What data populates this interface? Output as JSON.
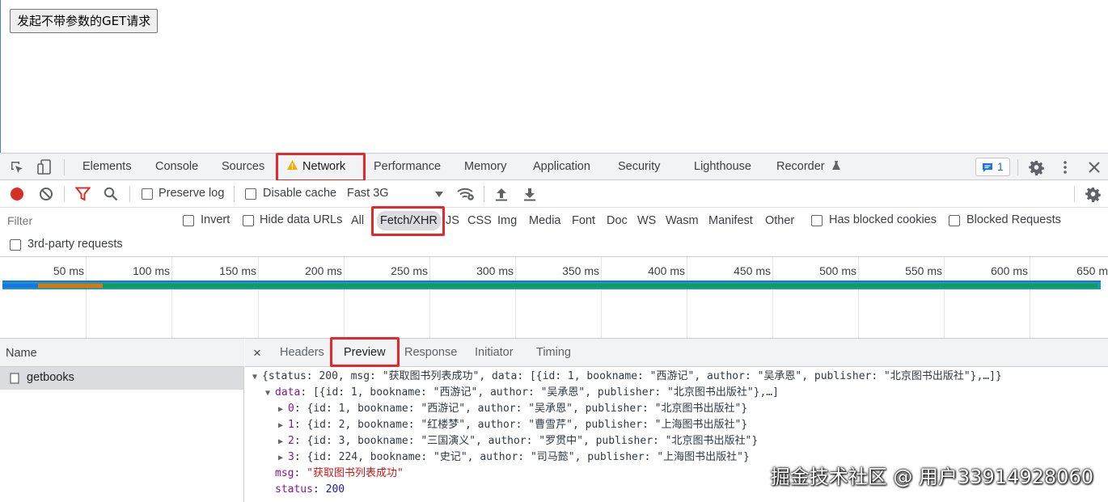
{
  "page": {
    "get_button": "发起不带参数的GET请求"
  },
  "devtools": {
    "tabs": [
      "Elements",
      "Console",
      "Sources",
      "Network",
      "Performance",
      "Memory",
      "Application",
      "Security",
      "Lighthouse",
      "Recorder"
    ],
    "issues_count": "1",
    "toolbar": {
      "preserve_log": "Preserve log",
      "disable_cache": "Disable cache",
      "throttling": "Fast 3G"
    },
    "filter": {
      "placeholder": "Filter",
      "invert": "Invert",
      "hide_data_urls": "Hide data URLs",
      "types": [
        "All",
        "Fetch/XHR",
        "JS",
        "CSS",
        "Img",
        "Media",
        "Font",
        "Doc",
        "WS",
        "Wasm",
        "Manifest",
        "Other"
      ],
      "has_blocked_cookies": "Has blocked cookies",
      "blocked_requests": "Blocked Requests",
      "third_party": "3rd-party requests"
    },
    "timeline": {
      "ticks": [
        "50 ms",
        "100 ms",
        "150 ms",
        "200 ms",
        "250 ms",
        "300 ms",
        "350 ms",
        "400 ms",
        "450 ms",
        "500 ms",
        "550 ms",
        "600 ms",
        "650 m"
      ]
    },
    "requests": {
      "header": "Name",
      "items": [
        "getbooks"
      ]
    },
    "detail": {
      "tabs": [
        "Headers",
        "Preview",
        "Response",
        "Initiator",
        "Timing"
      ],
      "close_label": "×",
      "preview": {
        "summary": "{status: 200, msg: \"获取图书列表成功\", data: [{id: 1, bookname: \"西游记\", author: \"吴承恩\", publisher: \"北京图书出版社\"},…]}",
        "data_key": "data",
        "data_summary": "[{id: 1, bookname: \"西游记\", author: \"吴承恩\", publisher: \"北京图书出版社\"},…]",
        "items": [
          {
            "index": "0",
            "text": "{id: 1, bookname: \"西游记\", author: \"吴承恩\", publisher: \"北京图书出版社\"}"
          },
          {
            "index": "1",
            "text": "{id: 2, bookname: \"红楼梦\", author: \"曹雪芹\", publisher: \"上海图书出版社\"}"
          },
          {
            "index": "2",
            "text": "{id: 3, bookname: \"三国演义\", author: \"罗贯中\", publisher: \"北京图书出版社\"}"
          },
          {
            "index": "3",
            "text": "{id: 224, bookname: \"史记\", author: \"司马懿\", publisher: \"上海图书出版社\"}"
          }
        ],
        "msg_key": "msg",
        "msg_value": "\"获取图书列表成功\"",
        "status_key": "status",
        "status_value": "200"
      }
    }
  },
  "watermark": "掘金技术社区 @ 用户33914928060"
}
